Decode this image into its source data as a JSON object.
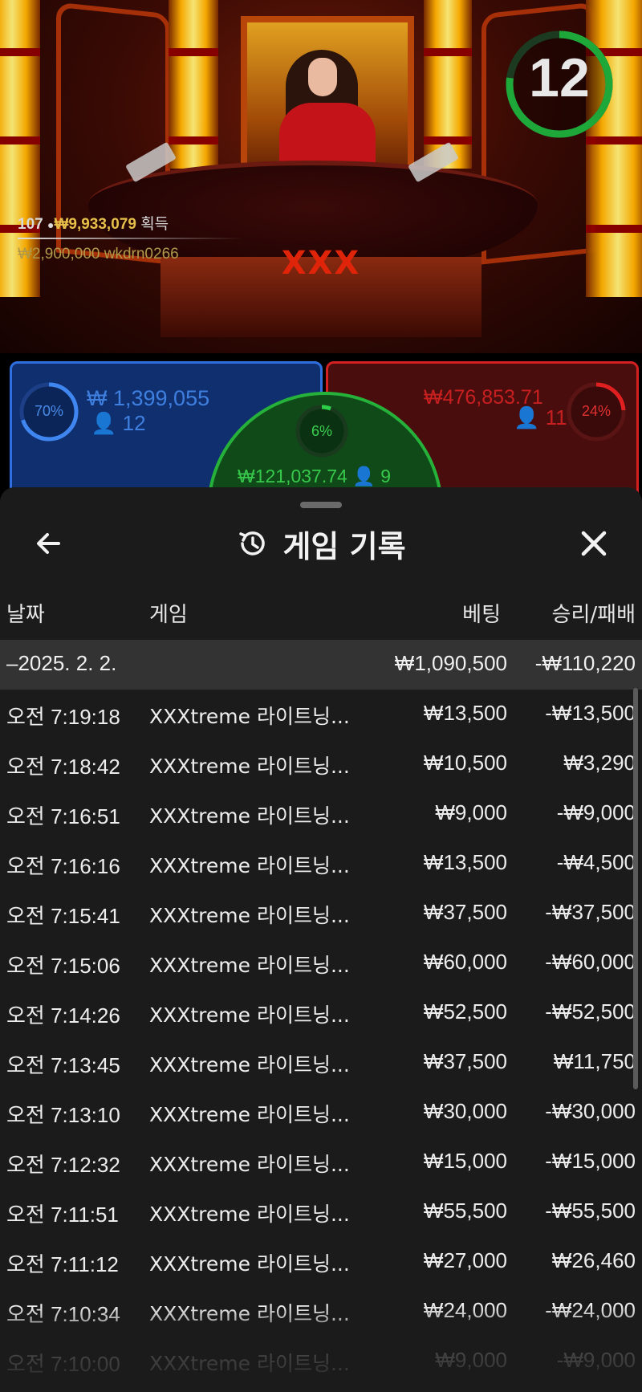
{
  "game_view": {
    "timer": "12",
    "timer_color": "#1fa83a",
    "table_logo": "XXX",
    "winner": {
      "count": "107",
      "amount": "₩9,933,079",
      "label": "획득",
      "top_bet": "₩2,900,000",
      "top_user": "wkdrn0266"
    }
  },
  "bets": {
    "player": {
      "percent": "70%",
      "percent_value": 0.7,
      "total": "₩ 1,399,055",
      "players": "12",
      "color": "#2f6fe0"
    },
    "banker": {
      "percent": "24%",
      "percent_value": 0.24,
      "total": "₩476,853.71",
      "players": "11",
      "color": "#d42020"
    },
    "tie": {
      "percent": "6%",
      "percent_value": 0.06,
      "total": "₩121,037.74",
      "players": "9",
      "color": "#26b23a"
    }
  },
  "history": {
    "title": "게임 기록",
    "back_icon": "arrow-left-icon",
    "history_icon": "history-icon",
    "close_icon": "close-icon",
    "columns": {
      "date": "날짜",
      "game": "게임",
      "bet": "베팅",
      "result": "승리/패배"
    },
    "group": {
      "date": "–2025. 2. 2.",
      "bet": "₩1,090,500",
      "result": "-₩110,220"
    },
    "rows": [
      {
        "time": "오전 7:19:18",
        "game": "XXXtreme 라이트닝...",
        "bet": "₩13,500",
        "result": "-₩13,500"
      },
      {
        "time": "오전 7:18:42",
        "game": "XXXtreme 라이트닝...",
        "bet": "₩10,500",
        "result": "₩3,290"
      },
      {
        "time": "오전 7:16:51",
        "game": "XXXtreme 라이트닝...",
        "bet": "₩9,000",
        "result": "-₩9,000"
      },
      {
        "time": "오전 7:16:16",
        "game": "XXXtreme 라이트닝...",
        "bet": "₩13,500",
        "result": "-₩4,500"
      },
      {
        "time": "오전 7:15:41",
        "game": "XXXtreme 라이트닝...",
        "bet": "₩37,500",
        "result": "-₩37,500"
      },
      {
        "time": "오전 7:15:06",
        "game": "XXXtreme 라이트닝...",
        "bet": "₩60,000",
        "result": "-₩60,000"
      },
      {
        "time": "오전 7:14:26",
        "game": "XXXtreme 라이트닝...",
        "bet": "₩52,500",
        "result": "-₩52,500"
      },
      {
        "time": "오전 7:13:45",
        "game": "XXXtreme 라이트닝...",
        "bet": "₩37,500",
        "result": "₩11,750"
      },
      {
        "time": "오전 7:13:10",
        "game": "XXXtreme 라이트닝...",
        "bet": "₩30,000",
        "result": "-₩30,000"
      },
      {
        "time": "오전 7:12:32",
        "game": "XXXtreme 라이트닝...",
        "bet": "₩15,000",
        "result": "-₩15,000"
      },
      {
        "time": "오전 7:11:51",
        "game": "XXXtreme 라이트닝...",
        "bet": "₩55,500",
        "result": "-₩55,500"
      },
      {
        "time": "오전 7:11:12",
        "game": "XXXtreme 라이트닝...",
        "bet": "₩27,000",
        "result": "₩26,460"
      },
      {
        "time": "오전 7:10:34",
        "game": "XXXtreme 라이트닝...",
        "bet": "₩24,000",
        "result": "-₩24,000"
      },
      {
        "time": "오전 7:10:00",
        "game": "XXXtreme 라이트닝...",
        "bet": "₩9,000",
        "result": "-₩9,000"
      }
    ]
  }
}
